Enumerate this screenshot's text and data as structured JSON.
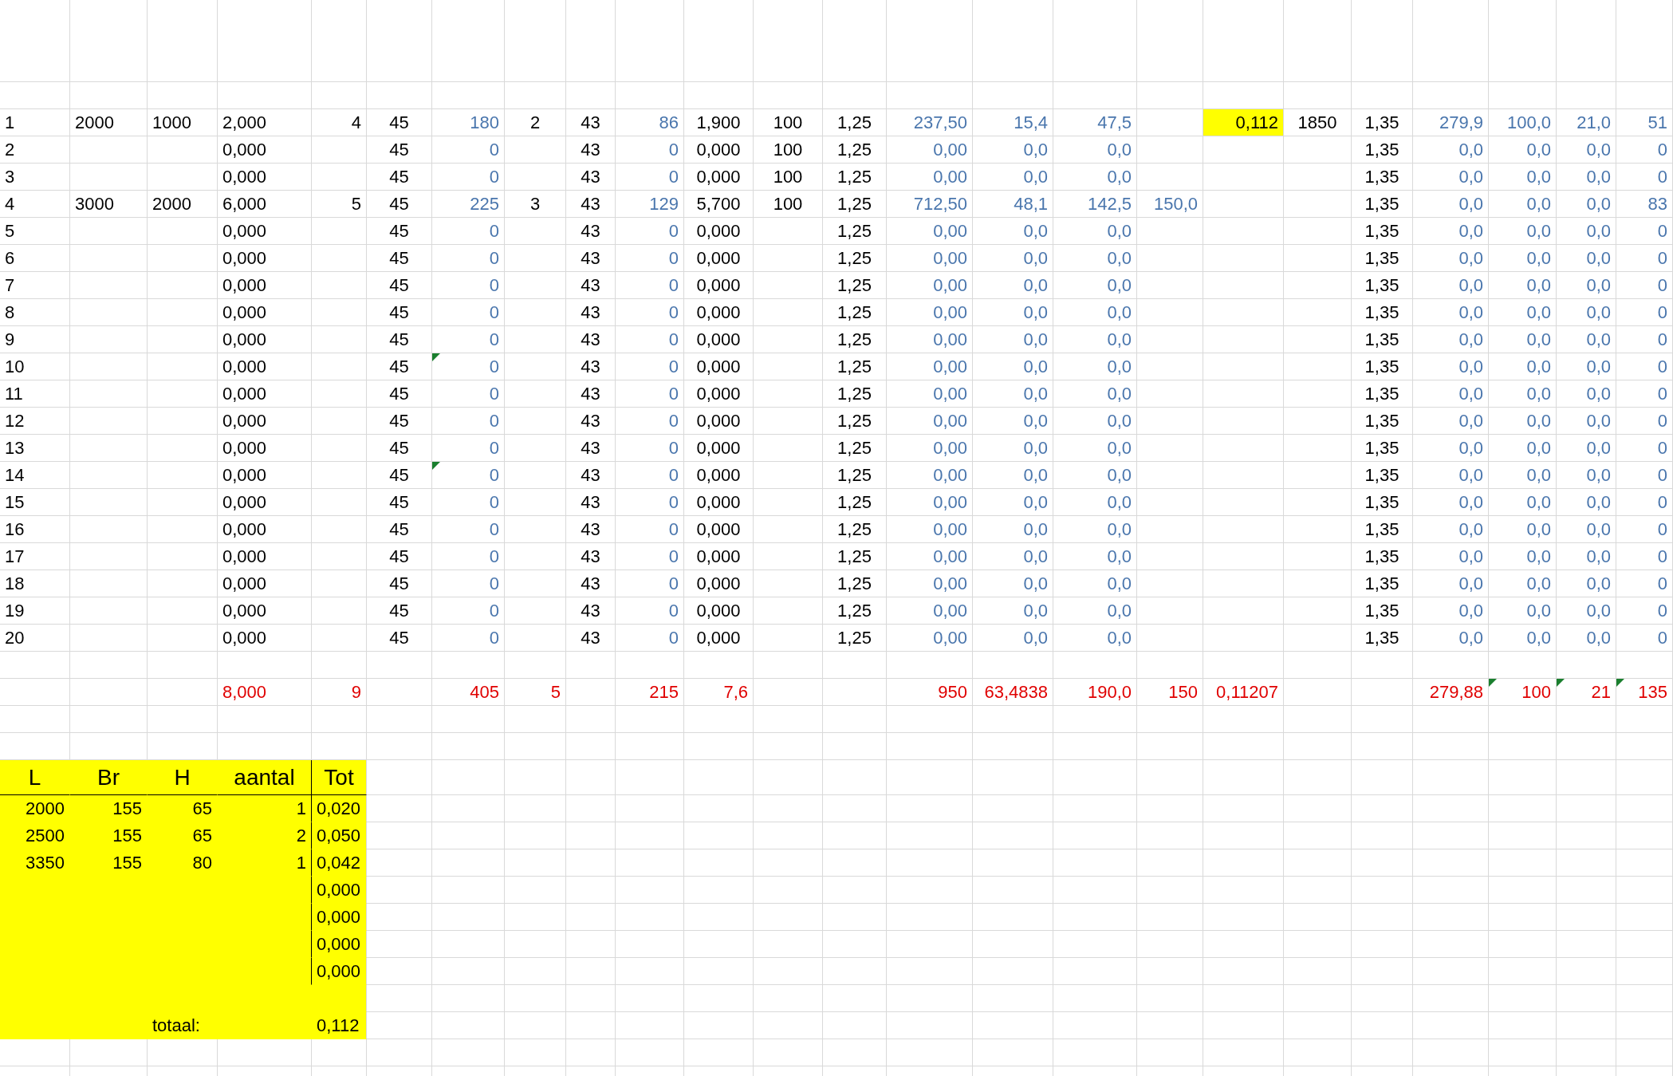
{
  "sheet": {
    "columns": [
      {
        "kind": "value"
      },
      {
        "kind": "value"
      },
      {
        "kind": "value"
      },
      {
        "kind": "value"
      },
      {
        "kind": "value"
      },
      {
        "kind": "value"
      },
      {
        "kind": "formula"
      },
      {
        "kind": "value"
      },
      {
        "kind": "value"
      },
      {
        "kind": "formula"
      },
      {
        "kind": "value"
      },
      {
        "kind": "value"
      },
      {
        "kind": "value"
      },
      {
        "kind": "formula"
      },
      {
        "kind": "formula"
      },
      {
        "kind": "formula"
      },
      {
        "kind": "formula"
      },
      {
        "kind": "value"
      },
      {
        "kind": "value"
      },
      {
        "kind": "value"
      },
      {
        "kind": "formula"
      },
      {
        "kind": "formula"
      },
      {
        "kind": "formula"
      },
      {
        "kind": "formula"
      }
    ],
    "rows": [
      {
        "kind": "data",
        "cells": [
          "1",
          "2000",
          "1000",
          "2,000",
          "4",
          "45",
          "180",
          "2",
          "43",
          "86",
          "1,900",
          "100",
          "1,25",
          "237,50",
          "15,4",
          "47,5",
          null,
          {
            "text": "0,112",
            "highlighted": true
          },
          "1850",
          "1,35",
          "279,9",
          "100,0",
          "21,0",
          "51"
        ]
      },
      {
        "kind": "data",
        "cells": [
          "2",
          null,
          null,
          "0,000",
          null,
          "45",
          "0",
          null,
          "43",
          "0",
          "0,000",
          "100",
          "1,25",
          "0,00",
          "0,0",
          "0,0",
          null,
          null,
          null,
          "1,35",
          "0,0",
          "0,0",
          "0,0",
          "0"
        ]
      },
      {
        "kind": "data",
        "cells": [
          "3",
          null,
          null,
          "0,000",
          null,
          "45",
          "0",
          null,
          "43",
          "0",
          "0,000",
          "100",
          "1,25",
          "0,00",
          "0,0",
          "0,0",
          null,
          null,
          null,
          "1,35",
          "0,0",
          "0,0",
          "0,0",
          "0"
        ]
      },
      {
        "kind": "data",
        "cells": [
          "4",
          "3000",
          "2000",
          "6,000",
          "5",
          "45",
          "225",
          "3",
          "43",
          "129",
          "5,700",
          "100",
          "1,25",
          "712,50",
          "48,1",
          "142,5",
          "150,0",
          null,
          null,
          "1,35",
          "0,0",
          "0,0",
          "0,0",
          "83"
        ]
      },
      {
        "kind": "data",
        "cells": [
          "5",
          null,
          null,
          "0,000",
          null,
          "45",
          "0",
          null,
          "43",
          "0",
          "0,000",
          null,
          "1,25",
          "0,00",
          "0,0",
          "0,0",
          null,
          null,
          null,
          "1,35",
          "0,0",
          "0,0",
          "0,0",
          "0"
        ]
      },
      {
        "kind": "data",
        "cells": [
          "6",
          null,
          null,
          "0,000",
          null,
          "45",
          "0",
          null,
          "43",
          "0",
          "0,000",
          null,
          "1,25",
          "0,00",
          "0,0",
          "0,0",
          null,
          null,
          null,
          "1,35",
          "0,0",
          "0,0",
          "0,0",
          "0"
        ]
      },
      {
        "kind": "data",
        "cells": [
          "7",
          null,
          null,
          "0,000",
          null,
          "45",
          "0",
          null,
          "43",
          "0",
          "0,000",
          null,
          "1,25",
          "0,00",
          "0,0",
          "0,0",
          null,
          null,
          null,
          "1,35",
          "0,0",
          "0,0",
          "0,0",
          "0"
        ]
      },
      {
        "kind": "data",
        "cells": [
          "8",
          null,
          null,
          "0,000",
          null,
          "45",
          "0",
          null,
          "43",
          "0",
          "0,000",
          null,
          "1,25",
          "0,00",
          "0,0",
          "0,0",
          null,
          null,
          null,
          "1,35",
          "0,0",
          "0,0",
          "0,0",
          "0"
        ]
      },
      {
        "kind": "data",
        "cells": [
          "9",
          null,
          null,
          "0,000",
          null,
          "45",
          "0",
          null,
          "43",
          "0",
          "0,000",
          null,
          "1,25",
          "0,00",
          "0,0",
          "0,0",
          null,
          null,
          null,
          "1,35",
          "0,0",
          "0,0",
          "0,0",
          "0"
        ]
      },
      {
        "kind": "data",
        "cells": [
          "10",
          null,
          null,
          "0,000",
          null,
          "45",
          {
            "text": "0",
            "error_flag": true
          },
          null,
          "43",
          "0",
          "0,000",
          null,
          "1,25",
          "0,00",
          "0,0",
          "0,0",
          null,
          null,
          null,
          "1,35",
          "0,0",
          "0,0",
          "0,0",
          "0"
        ]
      },
      {
        "kind": "data",
        "cells": [
          "11",
          null,
          null,
          "0,000",
          null,
          "45",
          "0",
          null,
          "43",
          "0",
          "0,000",
          null,
          "1,25",
          "0,00",
          "0,0",
          "0,0",
          null,
          null,
          null,
          "1,35",
          "0,0",
          "0,0",
          "0,0",
          "0"
        ]
      },
      {
        "kind": "data",
        "cells": [
          "12",
          null,
          null,
          "0,000",
          null,
          "45",
          "0",
          null,
          "43",
          "0",
          "0,000",
          null,
          "1,25",
          "0,00",
          "0,0",
          "0,0",
          null,
          null,
          null,
          "1,35",
          "0,0",
          "0,0",
          "0,0",
          "0"
        ]
      },
      {
        "kind": "data",
        "cells": [
          "13",
          null,
          null,
          "0,000",
          null,
          "45",
          "0",
          null,
          "43",
          "0",
          "0,000",
          null,
          "1,25",
          "0,00",
          "0,0",
          "0,0",
          null,
          null,
          null,
          "1,35",
          "0,0",
          "0,0",
          "0,0",
          "0"
        ]
      },
      {
        "kind": "data",
        "cells": [
          "14",
          null,
          null,
          "0,000",
          null,
          "45",
          {
            "text": "0",
            "error_flag": true
          },
          null,
          "43",
          "0",
          "0,000",
          null,
          "1,25",
          "0,00",
          "0,0",
          "0,0",
          null,
          null,
          null,
          "1,35",
          "0,0",
          "0,0",
          "0,0",
          "0"
        ]
      },
      {
        "kind": "data",
        "cells": [
          "15",
          null,
          null,
          "0,000",
          null,
          "45",
          "0",
          null,
          "43",
          "0",
          "0,000",
          null,
          "1,25",
          "0,00",
          "0,0",
          "0,0",
          null,
          null,
          null,
          "1,35",
          "0,0",
          "0,0",
          "0,0",
          "0"
        ]
      },
      {
        "kind": "data",
        "cells": [
          "16",
          null,
          null,
          "0,000",
          null,
          "45",
          "0",
          null,
          "43",
          "0",
          "0,000",
          null,
          "1,25",
          "0,00",
          "0,0",
          "0,0",
          null,
          null,
          null,
          "1,35",
          "0,0",
          "0,0",
          "0,0",
          "0"
        ]
      },
      {
        "kind": "data",
        "cells": [
          "17",
          null,
          null,
          "0,000",
          null,
          "45",
          "0",
          null,
          "43",
          "0",
          "0,000",
          null,
          "1,25",
          "0,00",
          "0,0",
          "0,0",
          null,
          null,
          null,
          "1,35",
          "0,0",
          "0,0",
          "0,0",
          "0"
        ]
      },
      {
        "kind": "data",
        "cells": [
          "18",
          null,
          null,
          "0,000",
          null,
          "45",
          "0",
          null,
          "43",
          "0",
          "0,000",
          null,
          "1,25",
          "0,00",
          "0,0",
          "0,0",
          null,
          null,
          null,
          "1,35",
          "0,0",
          "0,0",
          "0,0",
          "0"
        ]
      },
      {
        "kind": "data",
        "cells": [
          "19",
          null,
          null,
          "0,000",
          null,
          "45",
          "0",
          null,
          "43",
          "0",
          "0,000",
          null,
          "1,25",
          "0,00",
          "0,0",
          "0,0",
          null,
          null,
          null,
          "1,35",
          "0,0",
          "0,0",
          "0,0",
          "0"
        ]
      },
      {
        "kind": "data",
        "cells": [
          "20",
          null,
          null,
          "0,000",
          null,
          "45",
          "0",
          null,
          "43",
          "0",
          "0,000",
          null,
          "1,25",
          "0,00",
          "0,0",
          "0,0",
          null,
          null,
          null,
          "1,35",
          "0,0",
          "0,0",
          "0,0",
          "0"
        ]
      },
      {
        "kind": "totals",
        "cells": [
          null,
          null,
          null,
          "8,000",
          "9",
          null,
          "405",
          "5",
          null,
          "215",
          "7,6",
          null,
          null,
          "950",
          "63,4838",
          "190,0",
          "150",
          "0,11207",
          null,
          null,
          "279,88",
          {
            "text": "100",
            "error_flag": true
          },
          {
            "text": "21",
            "error_flag": true
          },
          {
            "text": "135",
            "error_flag": true
          }
        ]
      }
    ]
  },
  "stock_table": {
    "headers": [
      "L",
      "Br",
      "H",
      "aantal",
      "Tot"
    ],
    "rows": [
      [
        "2000",
        "155",
        "65",
        "1",
        "0,020"
      ],
      [
        "2500",
        "155",
        "65",
        "2",
        "0,050"
      ],
      [
        "3350",
        "155",
        "80",
        "1",
        "0,042"
      ],
      [
        null,
        null,
        null,
        null,
        "0,000"
      ],
      [
        null,
        null,
        null,
        null,
        "0,000"
      ],
      [
        null,
        null,
        null,
        null,
        "0,000"
      ],
      [
        null,
        null,
        null,
        null,
        "0,000"
      ]
    ],
    "total_label": "totaal:",
    "total": "0,112"
  }
}
